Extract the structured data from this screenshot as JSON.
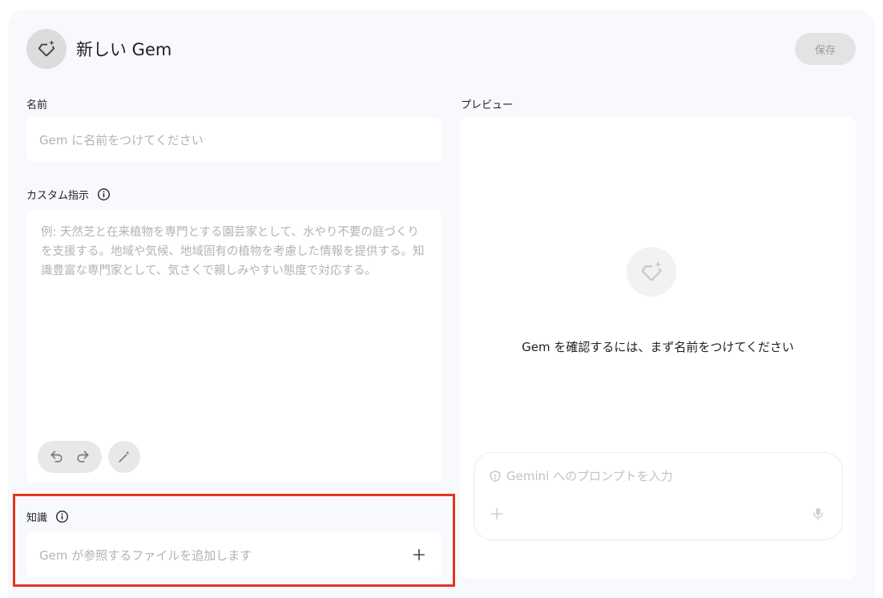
{
  "header": {
    "title": "新しい Gem",
    "save_label": "保存"
  },
  "name_section": {
    "label": "名前",
    "placeholder": "Gem に名前をつけてください"
  },
  "instructions_section": {
    "label": "カスタム指示",
    "placeholder": "例: 天然芝と在来植物を専門とする園芸家として、水やり不要の庭づくりを支援する。地域や気候、地域固有の植物を考慮した情報を提供する。知識豊富な専門家として、気さくで親しみやすい態度で対応する。"
  },
  "knowledge_section": {
    "label": "知識",
    "placeholder": "Gem が参照するファイルを追加します"
  },
  "preview": {
    "label": "プレビュー",
    "message": "Gem を確認するには、まず名前をつけてください",
    "prompt_placeholder": "Gemini へのプロンプトを入力"
  },
  "icons": {
    "avatar": "gem-sparkle-icon",
    "info": "info-icon",
    "undo": "undo-icon",
    "redo": "redo-icon",
    "magic": "magic-wand-icon",
    "add": "plus-icon",
    "shield": "shield-icon",
    "mic": "mic-icon"
  },
  "colors": {
    "highlight": "#e8341c",
    "panel": "#f8f9fd",
    "placeholder": "#b3b3b3"
  }
}
